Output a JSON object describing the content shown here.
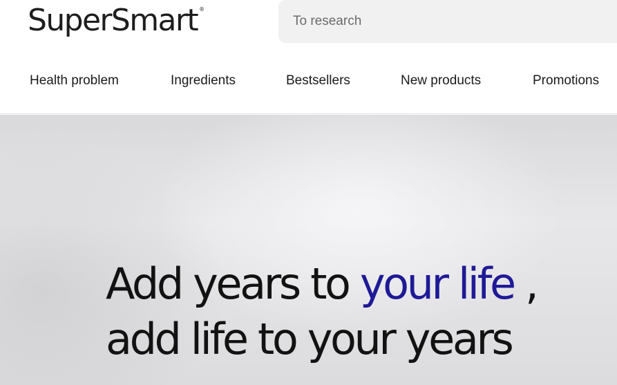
{
  "header": {
    "logo_text": "SuperSmart",
    "logo_mark": "®",
    "search": {
      "placeholder": "To research",
      "value": ""
    }
  },
  "nav": {
    "items": [
      {
        "label": "Health problem"
      },
      {
        "label": "Ingredients"
      },
      {
        "label": "Bestsellers"
      },
      {
        "label": "New products"
      },
      {
        "label": "Promotions"
      }
    ]
  },
  "hero": {
    "line1_part1": "Add years to ",
    "line1_accent": "your life",
    "line1_part2": " ,",
    "line2": "add life to your years"
  },
  "colors": {
    "accent": "#1f1a96",
    "text": "#121212",
    "search_bg": "#f1f1f1",
    "hero_bg": "#e3e3e5"
  }
}
